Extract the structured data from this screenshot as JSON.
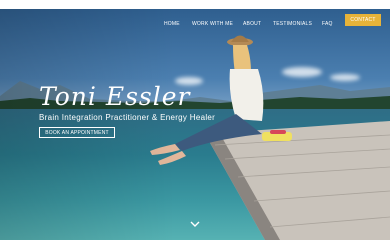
{
  "header": {
    "nav": [
      "Home",
      "Work With Me",
      "About",
      "Testimonials",
      "FAQ"
    ],
    "contact_label": "Contact",
    "accent_color": "#e7b339"
  },
  "hero": {
    "title": "Toni Essler",
    "tagline": "Brain Integration Practitioner & Energy Healer",
    "cta_label": "Book an Appointment",
    "scroll_icon": "chevron-down-icon"
  }
}
